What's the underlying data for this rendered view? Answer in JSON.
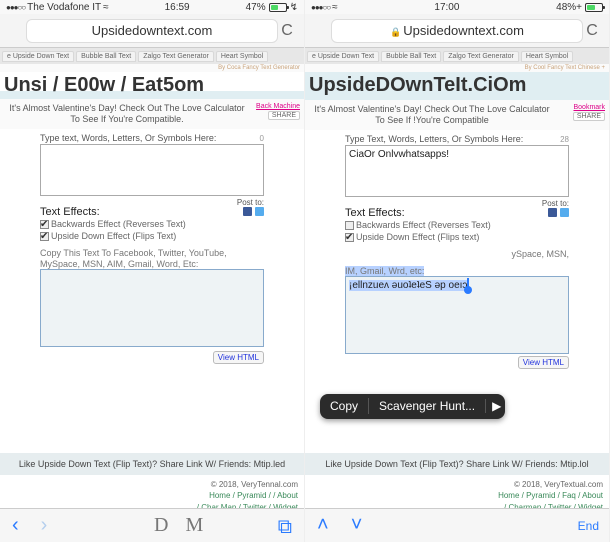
{
  "left": {
    "status": {
      "carrier": "The Vodafone IT",
      "signal": "●●●○○",
      "wifi": "≈",
      "time": "16:59",
      "battery_pct": "47%",
      "charging": "↯"
    },
    "nav": {
      "url": "Upsidedowntext.com",
      "reload": "C"
    },
    "tabs": [
      "e Upside Down Text",
      "Bubble Ball Text",
      "Zalgo Text Generator",
      "Heart Symbol"
    ],
    "credit": "By Coca Fancy Text Generator",
    "title": "Unsi / E00w / Eat5om",
    "valentine": "It's Almost Valentine's Day! Check Out The Love Calculator To See If You're Compatible.",
    "badge_link": "Back Machine",
    "badge_share": "SHARE",
    "input_label": "Type text, Words, Letters, Or Symbols Here:",
    "input_counter": "0",
    "input_value": "",
    "effects_title": "Text Effects:",
    "effect_backwards": "Backwards Effect (Reverses Text)",
    "effect_upside": "Upside Down Effect (Flips Text)",
    "post_to": "Post to:",
    "copy_label": "Copy This Text To Facebook, Twitter, YouTube, MySpace, MSN, AIM, Gmail, Word, Etc:",
    "output_value": "",
    "view_html": "View HTML",
    "share_text": "Like Upside Down Text (Flip Text)? Share Link W/ Friends: Mtip.led",
    "footer_copy": "© 2018, VeryTennal.com",
    "footer_links": "Home / Pyramid / / About\n/ Char Map / Twitter / Widget\n/ Bubble Text / Cool Text",
    "toolbar": {
      "back": "‹",
      "fwd": "›",
      "center": "D M",
      "tabs": "⧉"
    }
  },
  "right": {
    "status": {
      "carrier": "",
      "signal": "●●●○○",
      "wifi": "≈",
      "time": "17:00",
      "battery_pct": "48%+",
      "charging": ""
    },
    "nav": {
      "url": "Upsidedowntext.com",
      "reload": "C"
    },
    "tabs": [
      "e Upside Down Text",
      "Bubble Ball Text",
      "Zalgo Text Generator",
      "Heart Symbol"
    ],
    "credit": "By Cool Fancy Text Chinese +",
    "title": "UpsideDOwnTeIt.CiOm",
    "valentine": "It's Almost Valentine's Day! Check Out The Love Calculator To See If !You're Compatible",
    "badge_link": "Bookmark",
    "badge_share": "SHARE",
    "input_label": "Type Text, Words, Letters, Or Symbols Here:",
    "input_counter": "28",
    "input_value": "CiaOr Onlvwhatsapps!",
    "effects_title": "Text Effects:",
    "effect_backwards": "Backwards Effect (Reverses Text)",
    "effect_upside": "Upside Down Effect (Flips text)",
    "post_to": "Post to:",
    "selection_menu": {
      "copy": "Copy",
      "item2": "Scavenger Hunt..."
    },
    "copy_label_tail": "ySpace, MSN,",
    "copy_label_line2": "IM, Gmail, Wrd, etc:",
    "output_value": "¡ellnzueʌ əuoʇeʇeS əp oeıɔ",
    "view_html": "View HTML",
    "share_text": "Like Upside Down Text (Flip Text)? Share Link W/ Friends: Mtip.lol",
    "footer_copy": "© 2018, VeryTextual.com",
    "footer_links": "Home / Pyramid / Faq / About\n/ Charmap / Twitter / Widget\n/ Bubble text / Cooltext",
    "toolbar": {
      "up": "˄",
      "down": "˅",
      "done": "End"
    }
  }
}
